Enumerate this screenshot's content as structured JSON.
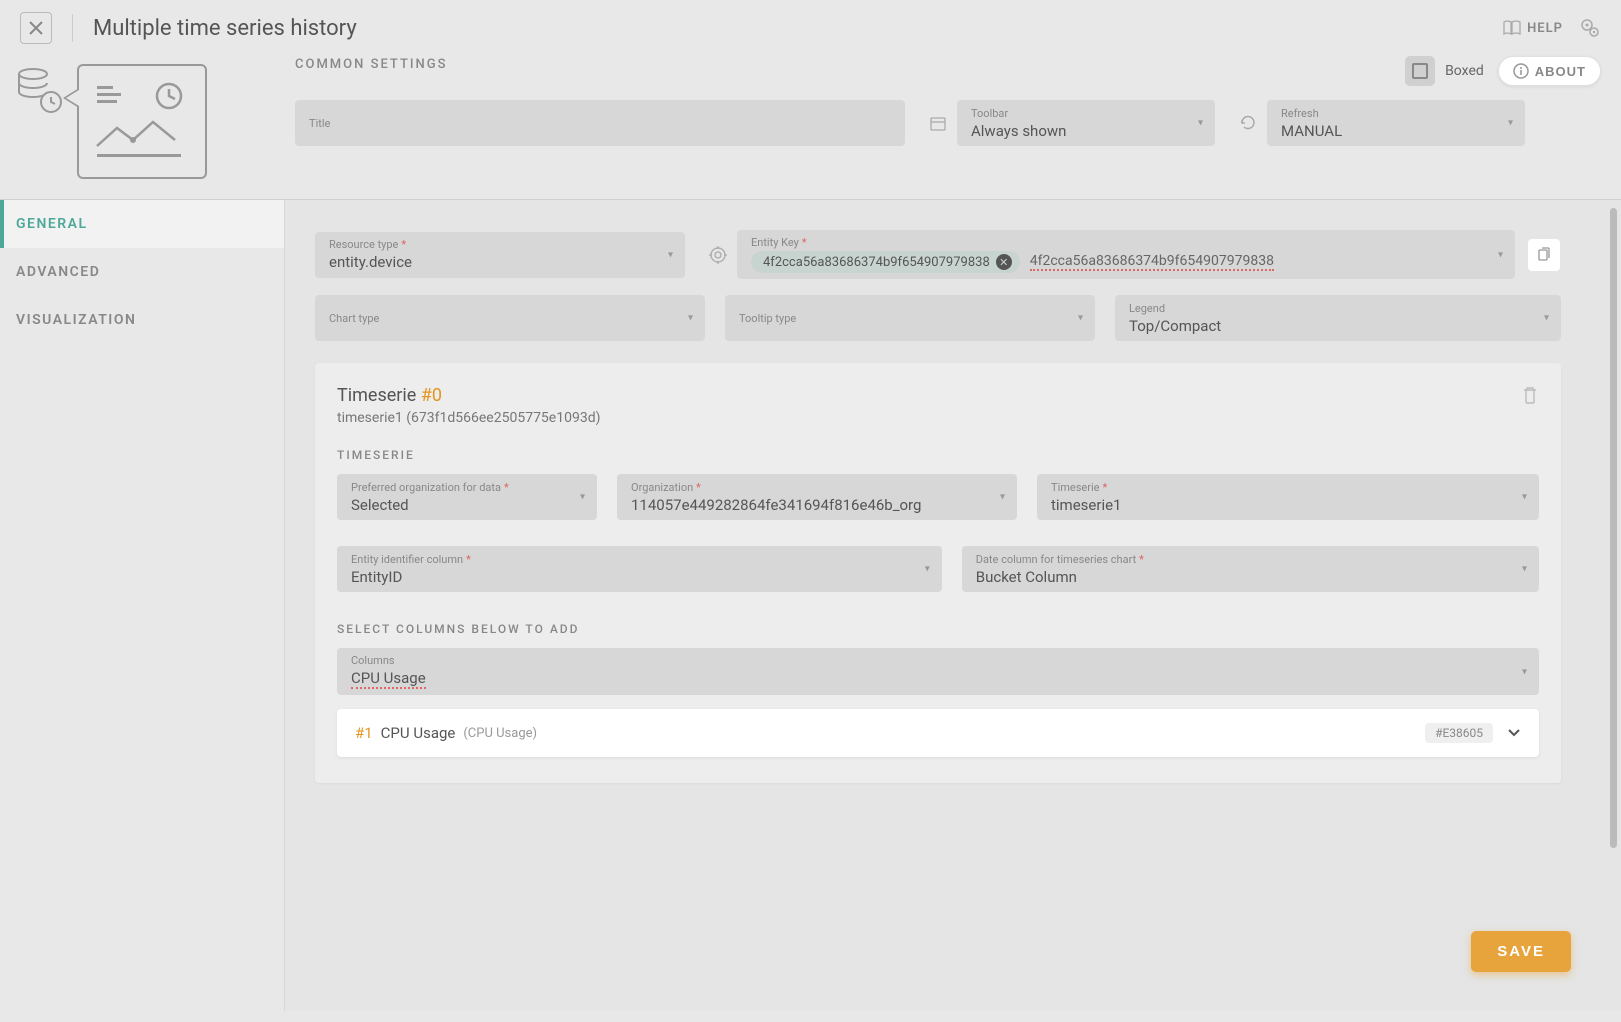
{
  "header": {
    "title": "Multiple time series history",
    "help": "HELP"
  },
  "common": {
    "section_label": "COMMON SETTINGS",
    "boxed_label": "Boxed",
    "about_label": "ABOUT",
    "title_label": "Title",
    "title_value": "",
    "toolbar_label": "Toolbar",
    "toolbar_value": "Always shown",
    "refresh_label": "Refresh",
    "refresh_value": "MANUAL"
  },
  "tabs": {
    "general": "GENERAL",
    "advanced": "ADVANCED",
    "visualization": "VISUALIZATION"
  },
  "general": {
    "resource_label": "Resource type",
    "resource_value": "entity.device",
    "entity_key_label": "Entity Key",
    "entity_chip": "4f2cca56a83686374b9f654907979838",
    "entity_text": "4f2cca56a83686374b9f654907979838",
    "chart_type_label": "Chart type",
    "tooltip_type_label": "Tooltip type",
    "legend_label": "Legend",
    "legend_value": "Top/Compact"
  },
  "timeserie": {
    "title_prefix": "Timeserie ",
    "title_idx": "#0",
    "subtitle": "timeserie1 (673f1d566ee2505775e1093d)",
    "section_label": "TIMESERIE",
    "pref_org_label": "Preferred organization for data",
    "pref_org_value": "Selected",
    "org_label": "Organization",
    "org_value": "114057e449282864fe341694f816e46b_org",
    "ts_label": "Timeserie",
    "ts_value": "timeserie1",
    "ent_col_label": "Entity identifier column",
    "ent_col_value": "EntityID",
    "date_col_label": "Date column for timeseries chart",
    "date_col_value": "Bucket Column",
    "select_cols_label": "SELECT COLUMNS BELOW TO ADD",
    "columns_label": "Columns",
    "columns_value": "CPU Usage",
    "column_item": {
      "idx": "#1",
      "name": "CPU Usage",
      "paren": "(CPU Usage)",
      "color": "#E38605"
    }
  },
  "save_label": "SAVE"
}
